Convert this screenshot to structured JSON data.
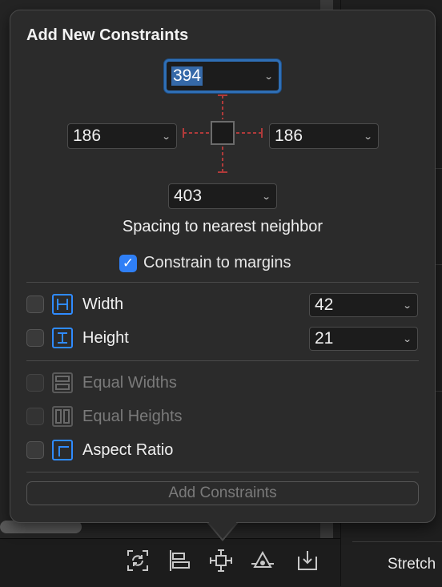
{
  "popover": {
    "title": "Add New Constraints",
    "spacing": {
      "top": "394",
      "left": "186",
      "right": "186",
      "bottom": "403"
    },
    "caption": "Spacing to nearest neighbor",
    "constrain_to_margins": {
      "label": "Constrain to margins",
      "checked": true
    },
    "options": [
      {
        "label": "Width",
        "checked": false,
        "enabled": true,
        "value": "42",
        "icon": "width-constraint-icon"
      },
      {
        "label": "Height",
        "checked": false,
        "enabled": true,
        "value": "21",
        "icon": "height-constraint-icon"
      },
      {
        "label": "Equal Widths",
        "checked": false,
        "enabled": false,
        "icon": "equal-widths-icon"
      },
      {
        "label": "Equal Heights",
        "checked": false,
        "enabled": false,
        "icon": "equal-heights-icon"
      },
      {
        "label": "Aspect Ratio",
        "checked": false,
        "enabled": true,
        "icon": "aspect-ratio-icon"
      }
    ],
    "add_button": "Add Constraints"
  },
  "background": {
    "stretch_label": "Stretch"
  },
  "toolbar": {
    "icons": [
      "update-frames-icon",
      "align-icon",
      "add-constraints-icon",
      "resolve-issues-icon",
      "embed-in-icon"
    ]
  },
  "colors": {
    "accent": "#2f7ff6",
    "focus_ring": "#2f6fb6",
    "constraint_strut": "#b03a3a"
  }
}
